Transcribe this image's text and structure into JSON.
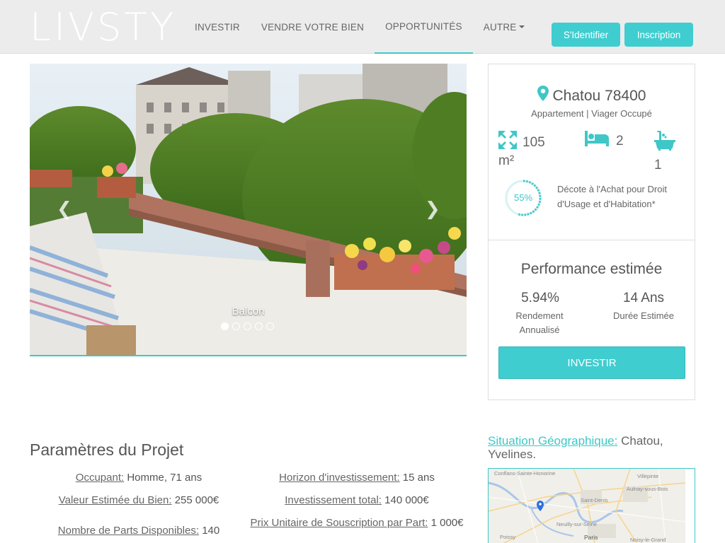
{
  "nav": {
    "logo": "LIVSTY",
    "links": [
      "INVESTIR",
      "VENDRE VOTRE BIEN",
      "OPPORTUNITÉS",
      "AUTRE"
    ],
    "login": "S'Identifier",
    "signup": "Inscription"
  },
  "carousel": {
    "caption": "Balcon",
    "slide_count": 5,
    "active_slide": 1
  },
  "property": {
    "location": "Chatou 78400",
    "type": "Appartement | Viager Occupé",
    "surface": "105",
    "surface_unit": "m²",
    "bedrooms": "2",
    "bathrooms": "1",
    "discount": "55%",
    "discount_fraction": 0.55,
    "discount_text": "Décote à l'Achat pour Droit d'Usage et d'Habitation*"
  },
  "performance": {
    "title": "Performance estimée",
    "yield_value": "5.94%",
    "yield_label": "Rendement Annualisé",
    "duration_value": "14 Ans",
    "duration_label": "Durée Estimée",
    "invest_button": "INVESTIR"
  },
  "params": {
    "title": "Paramètres du Projet",
    "occupant_k": "Occupant:",
    "occupant_v": "Homme, 71 ans",
    "horizon_k": "Horizon d'investissement:",
    "horizon_v": "15 ans",
    "valeur_k": "Valeur Estimée du Bien:",
    "valeur_v": "255 000€",
    "invest_k": "Investissement total:",
    "invest_v": "140 000€",
    "parts_k": "Nombre de Parts Disponibles:",
    "parts_v": "140",
    "prix_k": "Prix Unitaire de Souscription par Part:",
    "prix_v": "1 000€"
  },
  "geo": {
    "label": "Situation Géographique:",
    "value": "Chatou, Yvelines.",
    "map_labels": [
      "Conflans-Sainte-Honorine",
      "Villepinte",
      "Aulnay-sous-Bois",
      "Saint-Denis",
      "Poissy",
      "Neuilly-sur-Seine",
      "Paris",
      "Noisy-le-Grand"
    ]
  },
  "colors": {
    "accent": "#3fcdd0",
    "navbar": "#ececec"
  }
}
